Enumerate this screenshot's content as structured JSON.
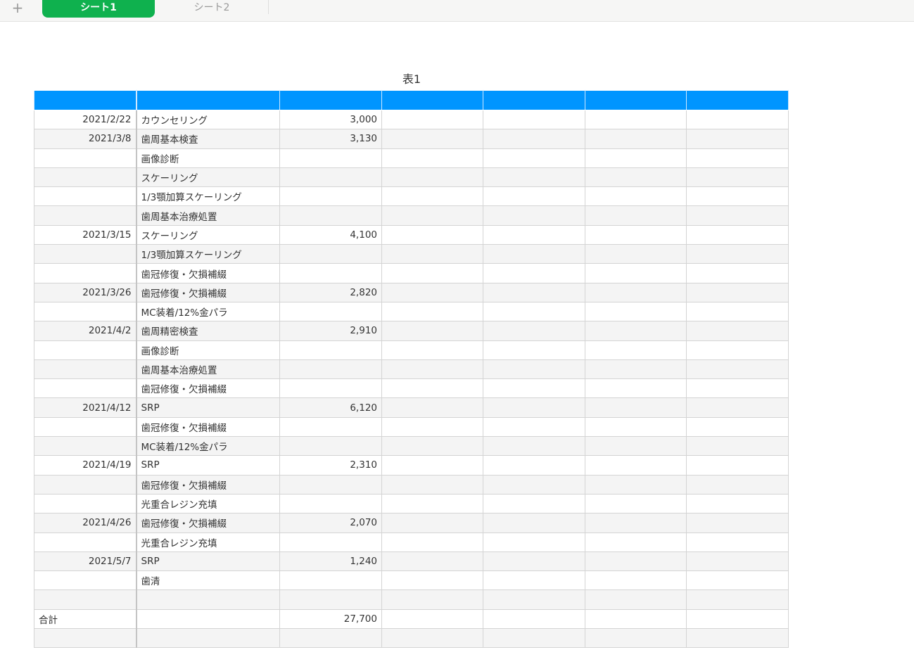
{
  "tabs": {
    "add": "+",
    "sheet1": "シート1",
    "sheet2": "シート2"
  },
  "table": {
    "title": "表1",
    "rows": [
      [
        "2021/2/22",
        "カウンセリング",
        "3,000"
      ],
      [
        "2021/3/8",
        "歯周基本検査",
        "3,130"
      ],
      [
        "",
        "画像診断",
        ""
      ],
      [
        "",
        "スケーリング",
        ""
      ],
      [
        "",
        "1/3顎加算スケーリング",
        ""
      ],
      [
        "",
        "歯周基本治療処置",
        ""
      ],
      [
        "2021/3/15",
        "スケーリング",
        "4,100"
      ],
      [
        "",
        "1/3顎加算スケーリング",
        ""
      ],
      [
        "",
        "歯冠修復・欠損補綴",
        ""
      ],
      [
        "2021/3/26",
        "歯冠修復・欠損補綴",
        "2,820"
      ],
      [
        "",
        "MC装着/12%金パラ",
        ""
      ],
      [
        "2021/4/2",
        "歯周精密検査",
        "2,910"
      ],
      [
        "",
        "画像診断",
        ""
      ],
      [
        "",
        "歯周基本治療処置",
        ""
      ],
      [
        "",
        "歯冠修復・欠損補綴",
        ""
      ],
      [
        "2021/4/12",
        "SRP",
        "6,120"
      ],
      [
        "",
        "歯冠修復・欠損補綴",
        ""
      ],
      [
        "",
        "MC装着/12%金パラ",
        ""
      ],
      [
        "2021/4/19",
        "SRP",
        "2,310"
      ],
      [
        "",
        "歯冠修復・欠損補綴",
        ""
      ],
      [
        "",
        "光重合レジン充填",
        ""
      ],
      [
        "2021/4/26",
        "歯冠修復・欠損補綴",
        "2,070"
      ],
      [
        "",
        "光重合レジン充填",
        ""
      ],
      [
        "2021/5/7",
        "SRP",
        "1,240"
      ],
      [
        "",
        "歯清",
        ""
      ],
      [
        "",
        "",
        ""
      ],
      [
        "合計",
        "",
        "27,700"
      ],
      [
        "",
        "",
        ""
      ]
    ]
  },
  "colors": {
    "header": "#0095ff",
    "active_tab": "#0fb14e"
  }
}
